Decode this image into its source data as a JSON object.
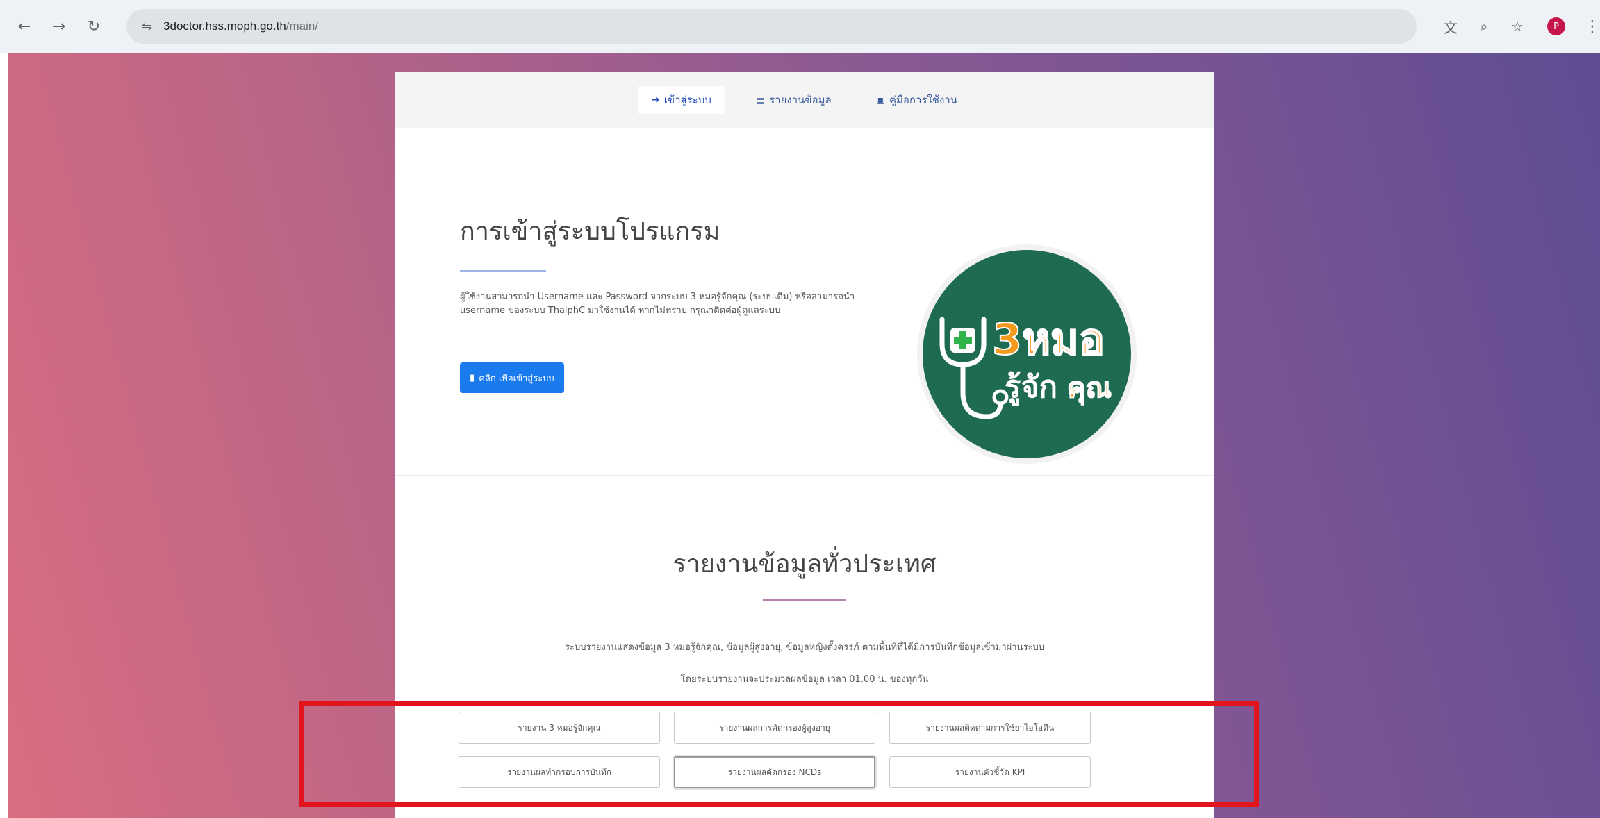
{
  "browser": {
    "url_host": "3doctor.hss.moph.go.th",
    "url_path": "/main/",
    "profile_initial": "P"
  },
  "nav": {
    "login": "เข้าสู่ระบบ",
    "report": "รายงานข้อมูล",
    "manual": "คู่มือการใช้งาน"
  },
  "login": {
    "title": "การเข้าสู่ระบบโปรแกรม",
    "description": "ผู้ใช้งานสามารถนำ Username และ Password จากระบบ 3 หมอรู้จักคุณ (ระบบเดิม) หรือสามารถนำ username ของระบบ ThaiphC มาใช้งานได้ หากไม่ทราบ กรุณาติดต่อผู้ดูแลระบบ",
    "button": "คลิก เพื่อเข้าสู่ระบบ"
  },
  "logo": {
    "line1": "3หมอ",
    "line2a": "รู้จัก",
    "line2b": "คุณ"
  },
  "report": {
    "title": "รายงานข้อมูลทั่วประเทศ",
    "desc1": "ระบบรายงานแสดงข้อมูล 3 หมอรู้จักคุณ, ข้อมูลผู้สูงอายุ, ข้อมูลหญิงตั้งครรภ์ ตามพื้นที่ที่ได้มีการบันทึกข้อมูลเข้ามาผ่านระบบ",
    "desc2": "โดยระบบรายงานจะประมวลผลข้อมูล เวลา 01.00 น. ของทุกวัน",
    "buttons": [
      "รายงาน 3 หมอรู้จักคุณ",
      "รายงานผลการคัดกรองผู้สูงอายุ",
      "รายงานผลติดตามการใช้ยาไอโอดีน",
      "รายงานผลทำกรอบการบันทึก",
      "รายงานผลคัดกรอง NCDs",
      "รายงานตัวชี้วัด KPI"
    ]
  },
  "colors": {
    "highlight": "#e2141c",
    "primary_button": "#1a7bef",
    "logo_green": "#1f6b52",
    "logo_orange": "#f39a1e"
  }
}
